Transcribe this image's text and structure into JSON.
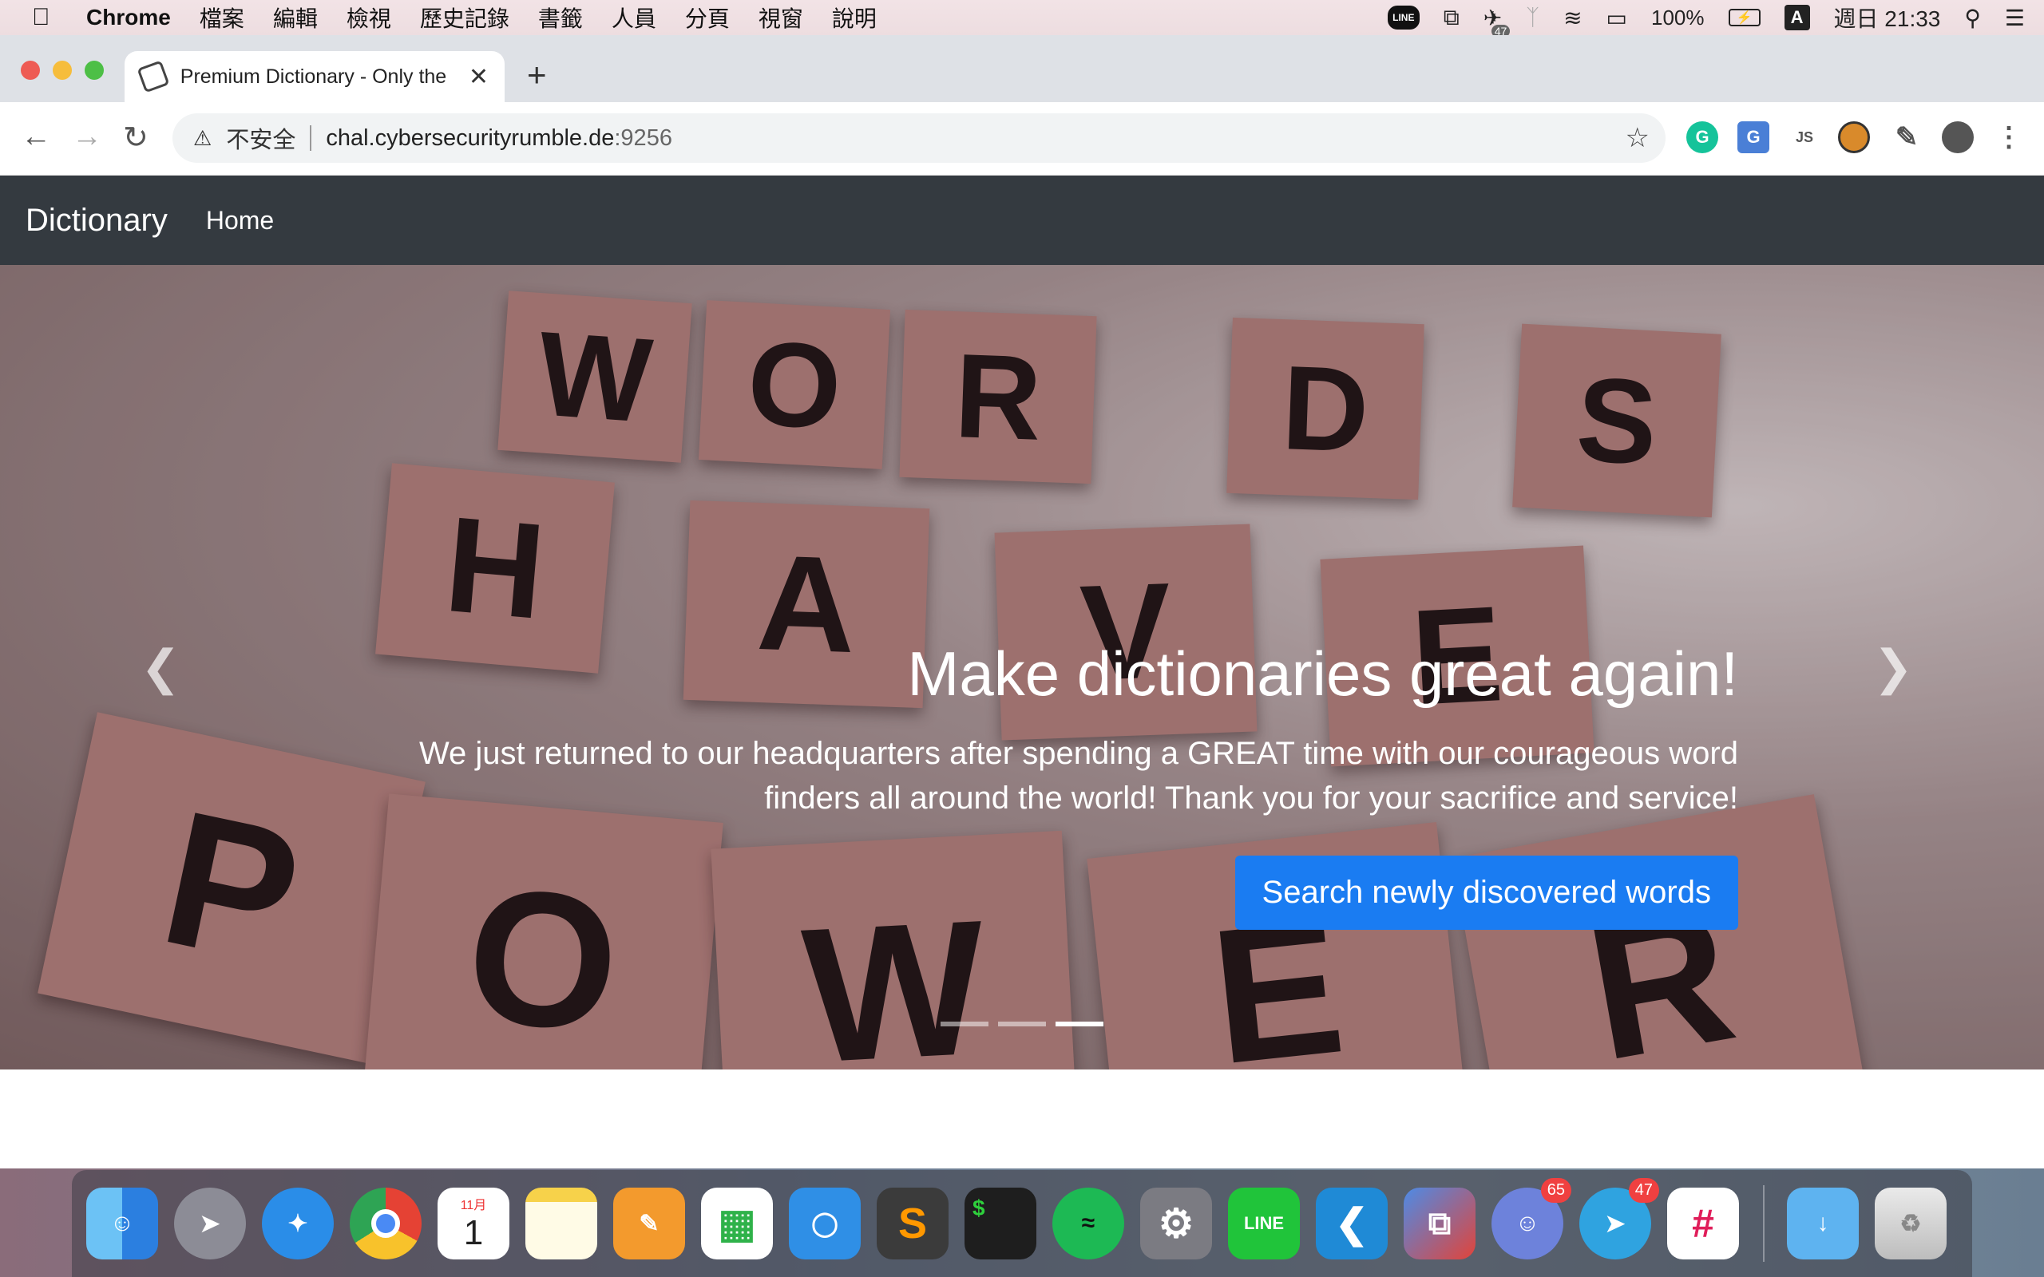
{
  "menubar": {
    "app_name": "Chrome",
    "items": [
      "檔案",
      "編輯",
      "檢視",
      "歷史記錄",
      "書籤",
      "人員",
      "分頁",
      "視窗",
      "說明"
    ],
    "line_icon": "LINE",
    "notification_count": "47",
    "battery": "100%",
    "input_source": "A",
    "clock": "週日 21:33"
  },
  "browser": {
    "tab_title": "Premium Dictionary - Only the",
    "security_label": "不安全",
    "url_host": "chal.cybersecurityrumble.de",
    "url_port": ":9256"
  },
  "site": {
    "brand": "Dictionary",
    "nav_home": "Home",
    "hero_title": "Make dictionaries great again!",
    "hero_text": "We just returned to our headquarters after spending a GREAT time with our courageous word finders all around the world! Thank you for your sacrifice and service!",
    "cta_label": "Search newly discovered words",
    "carousel_slide_count": 3,
    "carousel_active_slide": 3,
    "image_words": [
      "WORDS",
      "HAVE",
      "POWER"
    ]
  },
  "dock": {
    "calendar_month": "11月",
    "calendar_day": "1",
    "discord_badge": "65",
    "telegram_badge": "47",
    "line_label": "LINE"
  },
  "colors": {
    "navbar": "#343a40",
    "cta": "#1a7cf2",
    "tabbar": "#dee1e6"
  }
}
